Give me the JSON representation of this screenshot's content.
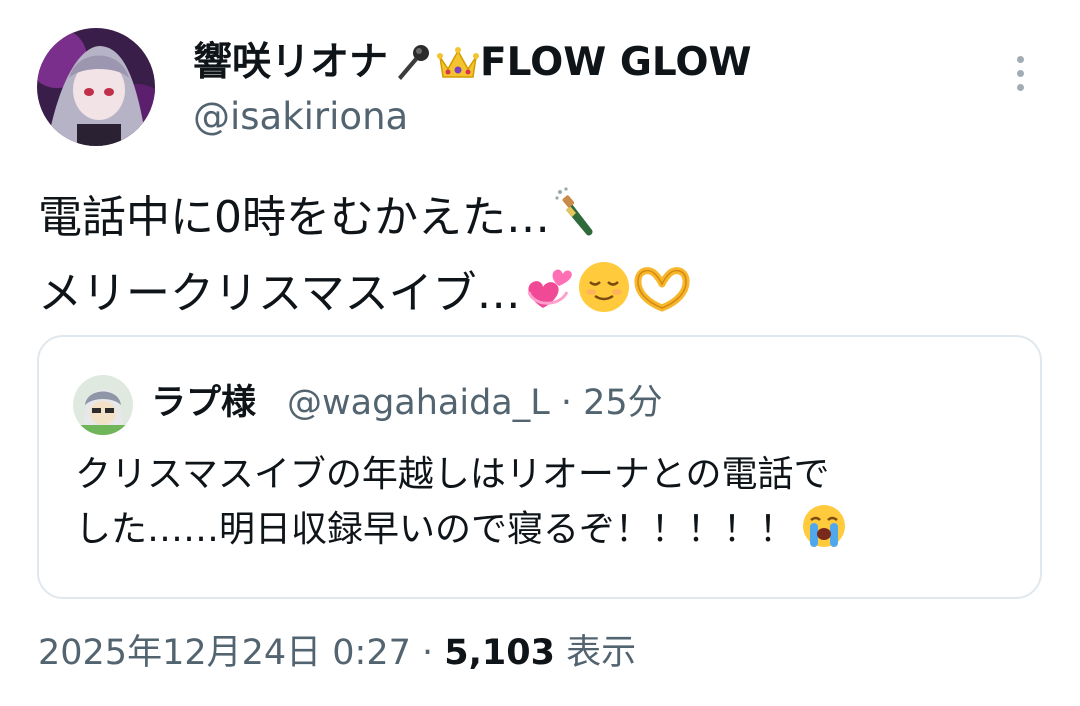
{
  "author": {
    "display_name": "響咲リオナ",
    "display_name_suffix": "FLOW GLOW",
    "handle": "@isakiriona",
    "name_icons": [
      "microphone-icon",
      "crown-icon"
    ]
  },
  "tweet": {
    "lines": [
      "電話中に0時をむかえた…",
      "メリークリスマスイブ…"
    ],
    "emojis": [
      "champagne-icon",
      "two-hearts-icon",
      "relieved-face-icon",
      "heart-hands-icon"
    ]
  },
  "quote": {
    "name": "ラプ様",
    "handle_time": "@wagahaida_L · 25分",
    "lines": [
      "クリスマスイブの年越しはリオーナとの電話で",
      "した……明日収録早いので寝るぞ！！！！！"
    ],
    "emoji": "loudly-crying-face-icon"
  },
  "meta": {
    "datetime": "2025年12月24日 0:27 · ",
    "views": "5,103",
    "views_label": " 表示"
  },
  "colors": {
    "text": "#0f1419",
    "secondary": "#536471",
    "border": "#e1e8ed"
  }
}
